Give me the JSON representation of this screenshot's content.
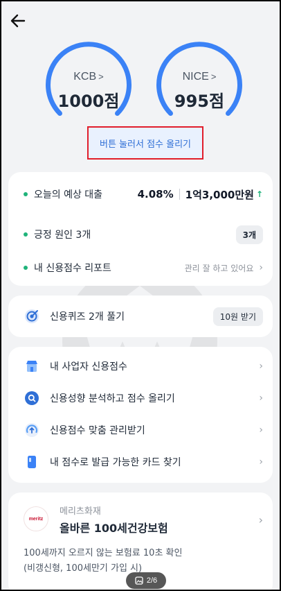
{
  "header": {
    "back_icon": "arrow-left-icon"
  },
  "scores": [
    {
      "bureau": "KCB",
      "chevron": ">",
      "score": "1000점"
    },
    {
      "bureau": "NICE",
      "chevron": ">",
      "score": "995점"
    }
  ],
  "boost_button": "버튼 눌러서 점수 올리기",
  "summary": {
    "loan_label": "오늘의 예상 대출",
    "loan_rate": "4.08%",
    "loan_amount": "1억3,000만원",
    "loan_trend_icon": "arrow-up-icon",
    "positive_label": "긍정 원인 3개",
    "positive_badge": "3개",
    "report_label": "내 신용점수 리포트",
    "report_status": "관리 잘 하고 있어요"
  },
  "quiz": {
    "label": "신용퀴즈 2개 풀기",
    "reward": "10원 받기",
    "icon": "target-icon"
  },
  "menu": [
    {
      "label": "내 사업자 신용점수",
      "icon": "store-icon"
    },
    {
      "label": "신용성향 분석하고 점수 올리기",
      "icon": "search-icon"
    },
    {
      "label": "신용점수 맞춤 관리받기",
      "icon": "gauge-icon"
    },
    {
      "label": "내 점수로 발급 가능한 카드 찾기",
      "icon": "card-icon"
    }
  ],
  "insurance": {
    "logo_text": "meritz",
    "company": "메리츠화재",
    "product": "올바른 100세건강보험",
    "desc_line1": "100세까지 오르지 않는 보험료 10초 확인",
    "desc_line2": "(비갱신형, 100세만기 가입 시)"
  },
  "pager": {
    "text": "2/6"
  },
  "colors": {
    "accent": "#3b82f6",
    "positive": "#1fb37a",
    "highlight_border": "#e11d2a"
  }
}
